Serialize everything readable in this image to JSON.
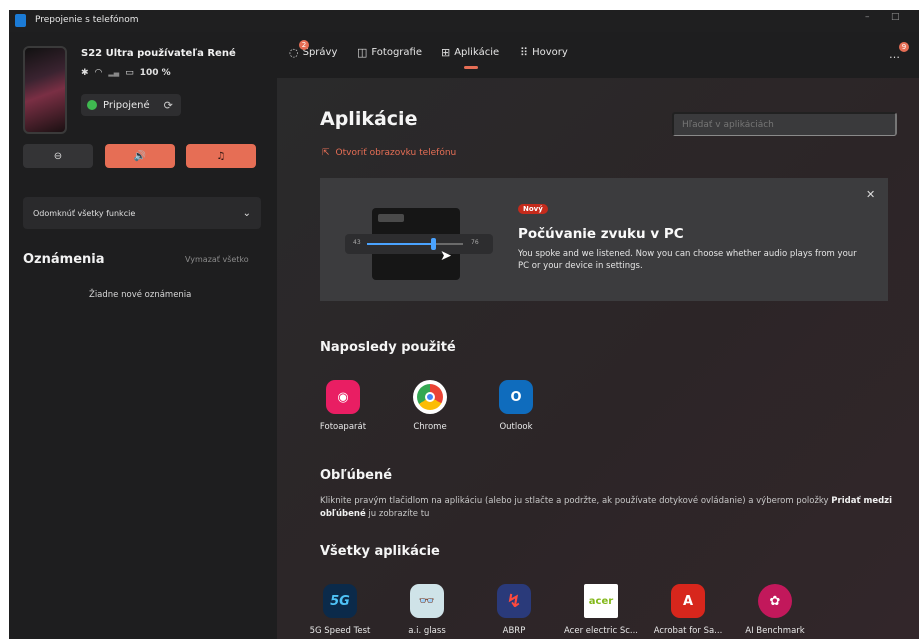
{
  "window": {
    "title": "Prepojenie s telefónom",
    "min": "–",
    "max": "□"
  },
  "device": {
    "name": "S22 Ultra používateľa René",
    "battery": "100 %",
    "connection": "Pripojené"
  },
  "quick_actions": {
    "dnd": "⊖",
    "sound": "🔊",
    "music": "♫"
  },
  "mute_all": {
    "label": "Odomknúť všetky funkcie",
    "chevron": "⌄"
  },
  "notifications": {
    "title": "Oznámenia",
    "clear": "Vymazať všetko",
    "empty": "Žiadne nové oznámenia"
  },
  "nav": {
    "tabs": [
      {
        "label": "Správy",
        "badge": "2"
      },
      {
        "label": "Fotografie"
      },
      {
        "label": "Aplikácie"
      },
      {
        "label": "Hovory"
      }
    ],
    "active": "Aplikácie",
    "corner_badge": "9"
  },
  "main": {
    "title": "Aplikácie",
    "search_placeholder": "Hľadať v aplikáciách",
    "open_screen": "Otvoriť obrazovku telefónu"
  },
  "banner": {
    "tag": "Nový",
    "title": "Počúvanie zvuku v PC",
    "text": "You spoke and we listened. Now you can choose whether audio plays from your PC or your device in settings.",
    "slider_min": "43",
    "slider_max": "76"
  },
  "recent": {
    "title": "Naposledy použité",
    "apps": [
      {
        "label": "Fotoaparát",
        "icon": "camera-icon",
        "color": "#e91e63"
      },
      {
        "label": "Chrome",
        "icon": "chrome-icon",
        "color": "#ffffff"
      },
      {
        "label": "Outlook",
        "icon": "outlook-icon",
        "color": "#0f6cbd"
      }
    ]
  },
  "favorites": {
    "title": "Obľúbené",
    "text_before": "Kliknite pravým tlačidlom na aplikáciu (alebo ju stlačte a podržte, ak používate dotykové ovládanie) a výberom položky ",
    "text_bold": "Pridať medzi obľúbené",
    "text_after": " ju zobrazíte tu"
  },
  "all_apps": {
    "title": "Všetky aplikácie",
    "apps": [
      {
        "label": "5G Speed Test",
        "icon": "5g-icon",
        "color": "#0b2a4a",
        "glyph": "5G"
      },
      {
        "label": "a.i. glass",
        "icon": "glasses-icon",
        "color": "#cfe3e8",
        "glyph": "👓"
      },
      {
        "label": "ABRP",
        "icon": "abrp-icon",
        "color": "#2a3a7a",
        "glyph": "↯"
      },
      {
        "label": "Acer electric Sc...",
        "icon": "acer-icon",
        "color": "#ffffff",
        "glyph": "acer"
      },
      {
        "label": "Acrobat for Sa...",
        "icon": "acrobat-icon",
        "color": "#d7261c",
        "glyph": "A"
      },
      {
        "label": "AI Benchmark",
        "icon": "ai-benchmark-icon",
        "color": "#c2185b",
        "glyph": "✿"
      }
    ]
  }
}
